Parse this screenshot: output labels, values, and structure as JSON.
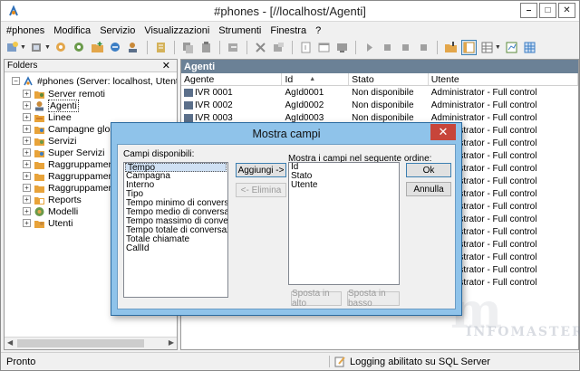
{
  "window": {
    "title": "#phones - [//localhost/Agenti]",
    "controls": {
      "minimize": "–",
      "maximize": "□",
      "close": "✕"
    }
  },
  "menu": [
    "#phones",
    "Modifica",
    "Servizio",
    "Visualizzazioni",
    "Strumenti",
    "Finestra",
    "?"
  ],
  "left_pane": {
    "title": "Folders",
    "close": "✕",
    "root_label": "#phones (Server: localhost, Utente: Adm",
    "items": [
      {
        "label": "Server remoti",
        "icon": "folder-icon"
      },
      {
        "label": "Agenti",
        "icon": "agents-icon",
        "selected": true
      },
      {
        "label": "Linee",
        "icon": "folder-icon"
      },
      {
        "label": "Campagne globali",
        "icon": "folder-icon"
      },
      {
        "label": "Servizi",
        "icon": "folder-icon"
      },
      {
        "label": "Super Servizi",
        "icon": "folder-icon"
      },
      {
        "label": "Raggruppamenti",
        "icon": "folder-icon"
      },
      {
        "label": "Raggruppamenti",
        "icon": "folder-icon"
      },
      {
        "label": "Raggruppamento",
        "icon": "folder-icon"
      },
      {
        "label": "Reports",
        "icon": "folder-icon"
      },
      {
        "label": "Modelli",
        "icon": "models-icon"
      },
      {
        "label": "Utenti",
        "icon": "folder-icon"
      }
    ]
  },
  "right_pane": {
    "title": "Agenti",
    "columns": [
      "Agente",
      "Id",
      "Stato",
      "Utente"
    ],
    "rows": [
      [
        "IVR 0001",
        "AgId0001",
        "Non disponibile",
        "Administrator - Full control"
      ],
      [
        "IVR 0002",
        "AgId0002",
        "Non disponibile",
        "Administrator - Full control"
      ],
      [
        "IVR 0003",
        "AgId0003",
        "Non disponibile",
        "Administrator - Full control"
      ],
      [
        "",
        "",
        "",
        "Administrator - Full control"
      ],
      [
        "",
        "",
        "",
        "Administrator - Full control"
      ],
      [
        "",
        "",
        "",
        "Administrator - Full control"
      ],
      [
        "",
        "",
        "",
        "Administrator - Full control"
      ],
      [
        "",
        "",
        "",
        "Administrator - Full control"
      ],
      [
        "",
        "",
        "",
        "Administrator - Full control"
      ],
      [
        "",
        "",
        "",
        "Administrator - Full control"
      ],
      [
        "",
        "",
        "",
        "Administrator - Full control"
      ],
      [
        "",
        "",
        "",
        "Administrator - Full control"
      ],
      [
        "",
        "",
        "",
        "Administrator - Full control"
      ],
      [
        "",
        "",
        "",
        "Administrator - Full control"
      ],
      [
        "",
        "",
        "",
        "Administrator - Full control"
      ],
      [
        "",
        "",
        "",
        "Administrator - Full control"
      ]
    ]
  },
  "watermark": {
    "mark": "m",
    "text": "INFOMASTER"
  },
  "status": {
    "left": "Pronto",
    "right": "Logging abilitato su SQL Server"
  },
  "dialog": {
    "title": "Mostra campi",
    "close": "✕",
    "available_label": "Campi disponibili:",
    "available": [
      "Tempo",
      "Campagna",
      "Interno",
      "Tipo",
      "Tempo minimo di conversazione",
      "Tempo medio di conversazione",
      "Tempo massimo di conversazione",
      "Tempo totale di conversazione",
      "Totale chiamate",
      "CallId"
    ],
    "order_label": "Mostra i campi nel seguente ordine:",
    "order": [
      "Id",
      "Stato",
      "Utente"
    ],
    "add_button": "Aggiungi ->",
    "remove_button": "<- Elimina",
    "move_up_button": "Sposta in alto",
    "move_down_button": "Sposta in basso",
    "ok_button": "Ok",
    "cancel_button": "Annulla"
  }
}
